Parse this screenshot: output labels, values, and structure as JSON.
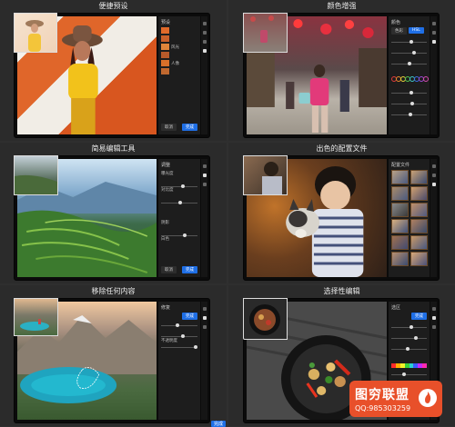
{
  "features": [
    {
      "title": "便捷预设",
      "panel_header": "预设",
      "list_items": [
        "",
        "",
        "风光",
        "",
        "人像",
        ""
      ],
      "cancel_label": "取消",
      "confirm_label": "完成"
    },
    {
      "title": "颜色增强",
      "panel_header": "颜色",
      "tab_labels": [
        "色彩",
        "HSL"
      ],
      "swatch_colors": [
        "#e23b3b",
        "#e98a2a",
        "#e8d43a",
        "#4ec24e",
        "#3fc8c8",
        "#3b6ee3",
        "#9b49d8",
        "#d64bb0"
      ]
    },
    {
      "title": "简易编辑工具",
      "panel_header": "调整",
      "rows": [
        "曝光度",
        "",
        "对比度",
        "",
        "",
        "",
        "阴影",
        "",
        "白色",
        ""
      ],
      "cancel_label": "取消",
      "confirm_label": "完成"
    },
    {
      "title": "出色的配置文件",
      "panel_header": "配置文件"
    },
    {
      "title": "移除任何内容",
      "panel_header": "修复",
      "rows": [
        "",
        "",
        "",
        "不透明度"
      ],
      "confirm_label": "完成"
    },
    {
      "title": "选择性编辑",
      "panel_header": "选区",
      "spectrum": [
        "#ff2a2a",
        "#ffae00",
        "#f2f22a",
        "#38d038",
        "#2ad0d0",
        "#3a5cff",
        "#c42aff",
        "#ff2ab0"
      ],
      "confirm_label": "完成"
    }
  ],
  "watermark": {
    "brand_text": "图穷联盟",
    "qq_text": "QQ:985303259"
  },
  "footer": {
    "corner_button_label": "完成"
  }
}
